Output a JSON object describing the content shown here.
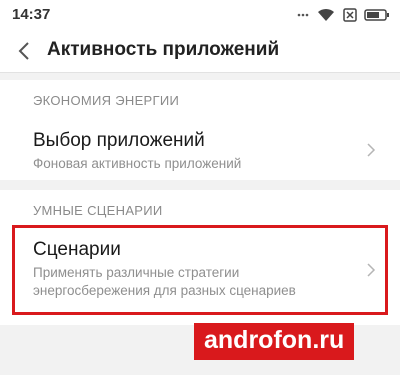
{
  "status_bar": {
    "time": "14:37",
    "icons": [
      "signal-dots-icon",
      "wifi-icon",
      "sim-off-icon",
      "battery-icon"
    ]
  },
  "header": {
    "back_icon": "chevron-left-icon",
    "title": "Активность приложений"
  },
  "sections": [
    {
      "header": "ЭКОНОМИЯ ЭНЕРГИИ",
      "items": [
        {
          "title": "Выбор приложений",
          "subtitle": "Фоновая активность приложений",
          "icon": "chevron-right-icon"
        }
      ]
    },
    {
      "header": "УМНЫЕ СЦЕНАРИИ",
      "items": [
        {
          "title": "Сценарии",
          "subtitle_line1": "Применять различные стратегии",
          "subtitle_line2": "энергосбережения для разных сценариев",
          "icon": "chevron-right-icon"
        }
      ]
    }
  ],
  "highlight_color": "#d9191c",
  "watermark": {
    "text": "androfon.ru"
  }
}
